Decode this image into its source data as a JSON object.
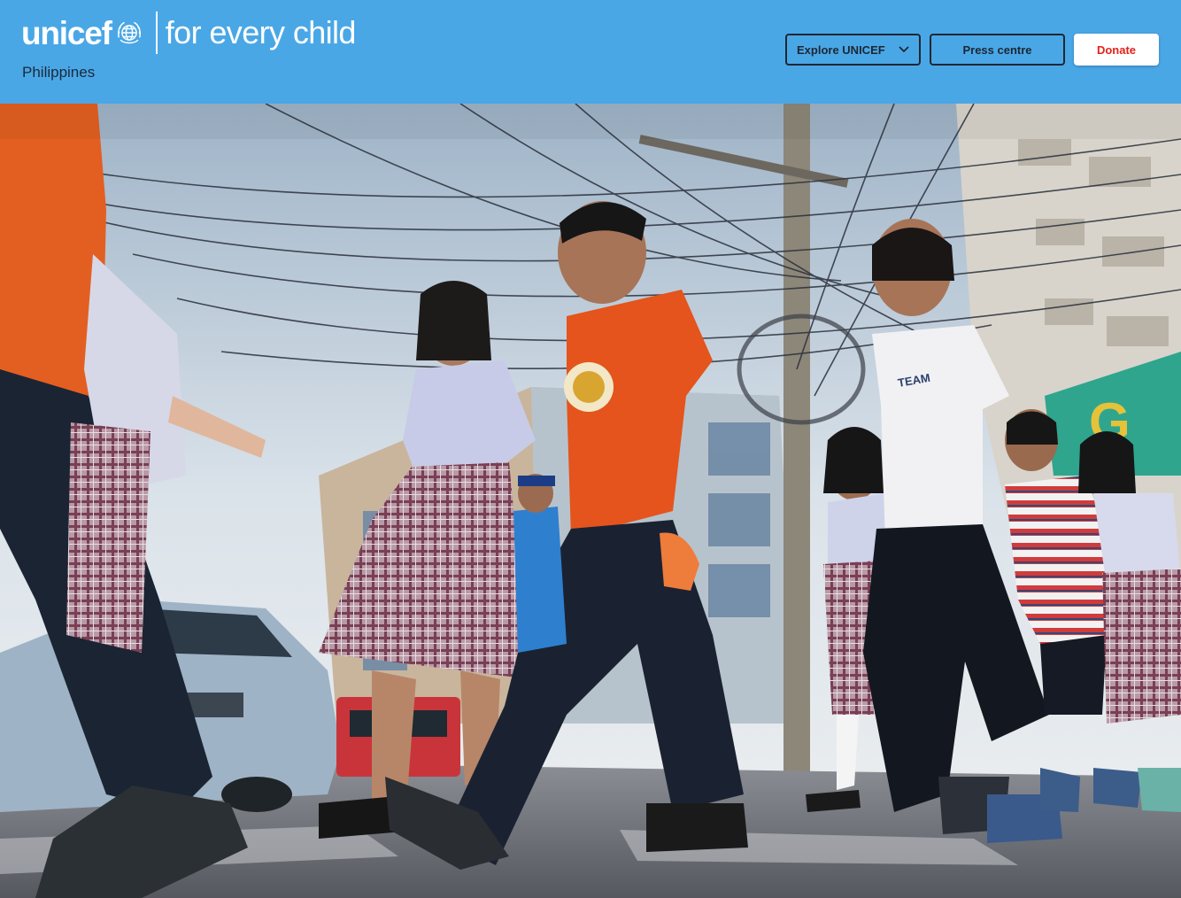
{
  "brand": {
    "wordmark": "unicef",
    "tagline": "for every child",
    "country": "Philippines",
    "emblem_icon": "unicef-globe-emblem-icon"
  },
  "nav": {
    "explore_label": "Explore UNICEF",
    "explore_icon": "chevron-down-icon",
    "press_label": "Press centre",
    "donate_label": "Donate"
  },
  "colors": {
    "header_bg": "#4aa7e6",
    "donate_text": "#e2231a",
    "button_outline": "#1c2733"
  },
  "hero": {
    "description_icon": "photo-children-crossing-street"
  }
}
